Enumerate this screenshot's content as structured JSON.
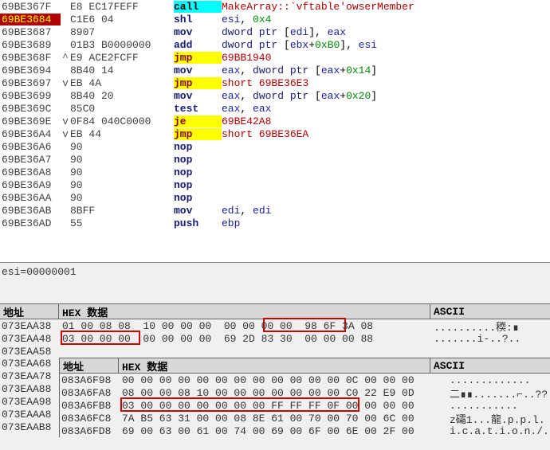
{
  "disasm": {
    "rows": [
      {
        "addr": "69BE367F",
        "exp": "",
        "bytes": "E8 EC17FEFF",
        "mnem": "call",
        "cls": "call",
        "ops": "<span class='lbl'>MakeArray::`vftable'owserMember</span>"
      },
      {
        "addr": "69BE3684",
        "exp": "",
        "bytes": "C1E6 04",
        "mnem": "shl",
        "cls": "shl",
        "ops": "<span class='reg'>esi</span>, <span class='num'>0x4</span>",
        "sel": true
      },
      {
        "addr": "69BE3687",
        "exp": "",
        "bytes": "8907",
        "mnem": "mov",
        "cls": "mov",
        "ops": "<span class='kw'>dword ptr</span> [<span class='reg'>edi</span>], <span class='reg'>eax</span>"
      },
      {
        "addr": "69BE3689",
        "exp": "",
        "bytes": "01B3 B0000000",
        "mnem": "add",
        "cls": "add",
        "ops": "<span class='kw'>dword ptr</span> [<span class='reg'>ebx</span>+<span class='num'>0xB0</span>], <span class='reg'>esi</span>"
      },
      {
        "addr": "69BE368F",
        "exp": "^",
        "bytes": "E9 ACE2FCFF",
        "mnem": "jmp",
        "cls": "jmp",
        "ops": "<span class='lbl'>69BB1940</span>"
      },
      {
        "addr": "69BE3694",
        "exp": "",
        "bytes": "8B40 14",
        "mnem": "mov",
        "cls": "mov",
        "ops": "<span class='reg'>eax</span>, <span class='kw'>dword ptr</span> [<span class='reg'>eax</span>+<span class='num'>0x14</span>]"
      },
      {
        "addr": "69BE3697",
        "exp": "v",
        "bytes": "EB 4A",
        "mnem": "jmp",
        "cls": "jmp",
        "ops": "<span class='lbl'>short 69BE36E3</span>"
      },
      {
        "addr": "69BE3699",
        "exp": "",
        "bytes": "8B40 20",
        "mnem": "mov",
        "cls": "mov",
        "ops": "<span class='reg'>eax</span>, <span class='kw'>dword ptr</span> [<span class='reg'>eax</span>+<span class='num'>0x20</span>]"
      },
      {
        "addr": "69BE369C",
        "exp": "",
        "bytes": "85C0",
        "mnem": "test",
        "cls": "test",
        "ops": "<span class='reg'>eax</span>, <span class='reg'>eax</span>"
      },
      {
        "addr": "69BE369E",
        "exp": "v",
        "bytes": "0F84 040C0000",
        "mnem": "je",
        "cls": "je",
        "ops": "<span class='lbl'>69BE42A8</span>"
      },
      {
        "addr": "69BE36A4",
        "exp": "v",
        "bytes": "EB 44",
        "mnem": "jmp",
        "cls": "jmp",
        "ops": "<span class='lbl'>short 69BE36EA</span>"
      },
      {
        "addr": "69BE36A6",
        "exp": "",
        "bytes": "90",
        "mnem": "nop",
        "cls": "nop",
        "ops": ""
      },
      {
        "addr": "69BE36A7",
        "exp": "",
        "bytes": "90",
        "mnem": "nop",
        "cls": "nop",
        "ops": ""
      },
      {
        "addr": "69BE36A8",
        "exp": "",
        "bytes": "90",
        "mnem": "nop",
        "cls": "nop",
        "ops": ""
      },
      {
        "addr": "69BE36A9",
        "exp": "",
        "bytes": "90",
        "mnem": "nop",
        "cls": "nop",
        "ops": ""
      },
      {
        "addr": "69BE36AA",
        "exp": "",
        "bytes": "90",
        "mnem": "nop",
        "cls": "nop",
        "ops": ""
      },
      {
        "addr": "69BE36AB",
        "exp": "",
        "bytes": "8BFF",
        "mnem": "mov",
        "cls": "mov",
        "ops": "<span class='reg'>edi</span>, <span class='reg'>edi</span>"
      },
      {
        "addr": "69BE36AD",
        "exp": "",
        "bytes": "55",
        "mnem": "push",
        "cls": "push",
        "ops": "<span class='reg'>ebp</span>"
      }
    ]
  },
  "status": "esi=00000001",
  "dump1": {
    "hdr": {
      "c1": "地址",
      "c2": "HEX 数据",
      "c3": "ASCII"
    },
    "rows": [
      {
        "a": "073EAA38",
        "h": "01 00 08 08  10 00 00 00  00 00 00 00  98 6F 3A 08",
        "s": "..........稬:∎"
      },
      {
        "a": "073EAA48",
        "h": "03 00 00 00  00 00 00 00  69 2D 83 30  00 00 00 88",
        "s": ".......i-..?.."
      },
      {
        "a": "073EAA58",
        "h": "",
        "s": ""
      }
    ]
  },
  "outer_addrs": [
    "073EAA68",
    "073EAA78",
    "073EAA88",
    "073EAA98",
    "073EAAA8",
    "073EAAB8"
  ],
  "dump2": {
    "hdr": {
      "c1": "地址",
      "c2": "HEX 数据",
      "c3": "ASCII"
    },
    "rows": [
      {
        "a": "083A6F98",
        "h": "00 00 00 00 00 00 00 00 00 00 00 00 0C 00 00 00",
        "s": "............."
      },
      {
        "a": "083A6FA8",
        "h": "08 00 00 08 10 00 00 00 00 00 00 00 C0 22 E9 0D",
        "s": "二∎∎.......⌐..??"
      },
      {
        "a": "083A6FB8",
        "h": "03 00 00 00 00 00 00 00 FF FF FF 0F 00 00 00 00",
        "s": "..........."
      },
      {
        "a": "083A6FC8",
        "h": "7A B5 63 31 00 00 08 8E 61 00 70 00 70 00 6C 00",
        "s": "z礵1...龍.p.p.l."
      },
      {
        "a": "083A6FD8",
        "h": "69 00 63 00 61 00 74 00 69 00 6F 00 6E 00 2F 00",
        "s": "i.c.a.t.i.o.n./."
      }
    ]
  }
}
